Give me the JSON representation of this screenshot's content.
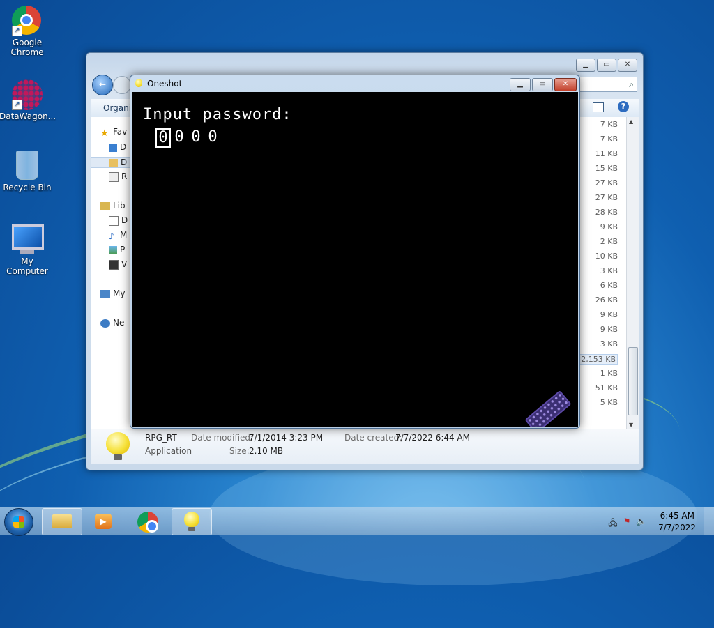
{
  "desktop": {
    "icons": [
      {
        "label": "Google Chrome",
        "icon": "chrome-icon"
      },
      {
        "label": "DataWagon...",
        "icon": "datawagon-icon"
      },
      {
        "label": "Recycle Bin",
        "icon": "recycle-bin-icon"
      },
      {
        "label": "My Computer",
        "icon": "my-computer-icon"
      }
    ]
  },
  "explorer": {
    "toolbar": {
      "organize": "Organi"
    },
    "nav": {
      "favorites": "Fav",
      "desktop": "D",
      "downloads": "D",
      "recent": "R",
      "libraries": "Lib",
      "documents": "D",
      "music": "M",
      "pictures": "P",
      "videos": "V",
      "computer": "My",
      "network": "Ne"
    },
    "sizes": [
      "7 KB",
      "7 KB",
      "11 KB",
      "15 KB",
      "27 KB",
      "27 KB",
      "28 KB",
      "9 KB",
      "2 KB",
      "10 KB",
      "3 KB",
      "6 KB",
      "26 KB",
      "9 KB",
      "9 KB",
      "3 KB",
      "2,153 KB",
      "1 KB",
      "51 KB",
      "5 KB"
    ],
    "details": {
      "name": "RPG_RT",
      "type": "Application",
      "date_modified_label": "Date modified:",
      "date_modified": "7/1/2014 3:23 PM",
      "size_label": "Size:",
      "size": "2.10 MB",
      "date_created_label": "Date created:",
      "date_created": "7/7/2022 6:44 AM"
    }
  },
  "oneshot": {
    "title": "Oneshot",
    "prompt": "Input password:",
    "digits": [
      "0",
      "0",
      "0",
      "0"
    ],
    "active_digit": 0
  },
  "taskbar": {
    "time": "6:45 AM",
    "date": "7/7/2022"
  }
}
